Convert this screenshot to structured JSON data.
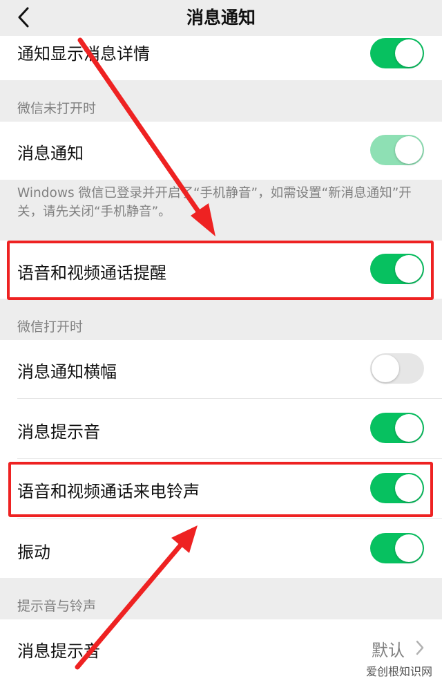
{
  "nav": {
    "title": "消息通知"
  },
  "rows": {
    "detail": {
      "label": "通知显示消息详情",
      "state": "on"
    },
    "closed_section": {
      "title": "微信未打开时"
    },
    "msg_notify": {
      "label": "消息通知",
      "state": "dimmed-on"
    },
    "note": "Windows 微信已登录并开启了“手机静音”，如需设置“新消息通知”开关，请先关闭“手机静音”。",
    "call_alert": {
      "label": "语音和视频通话提醒",
      "state": "on"
    },
    "open_section": {
      "title": "微信打开时"
    },
    "banner": {
      "label": "消息通知横幅",
      "state": "off"
    },
    "msg_sound": {
      "label": "消息提示音",
      "state": "on"
    },
    "call_ringtone": {
      "label": "语音和视频通话来电铃声",
      "state": "on"
    },
    "vibrate": {
      "label": "振动",
      "state": "on"
    },
    "sound_section": {
      "title": "提示音与铃声"
    },
    "sound_pick": {
      "label": "消息提示音",
      "value": "默认"
    }
  },
  "watermark": "爱创根知识网",
  "colors": {
    "accent": "#07c160",
    "annotation": "#ee2222",
    "background": "#ededed"
  },
  "icons": {
    "back": "chevron-left-icon",
    "disclosure": "chevron-right-icon"
  }
}
